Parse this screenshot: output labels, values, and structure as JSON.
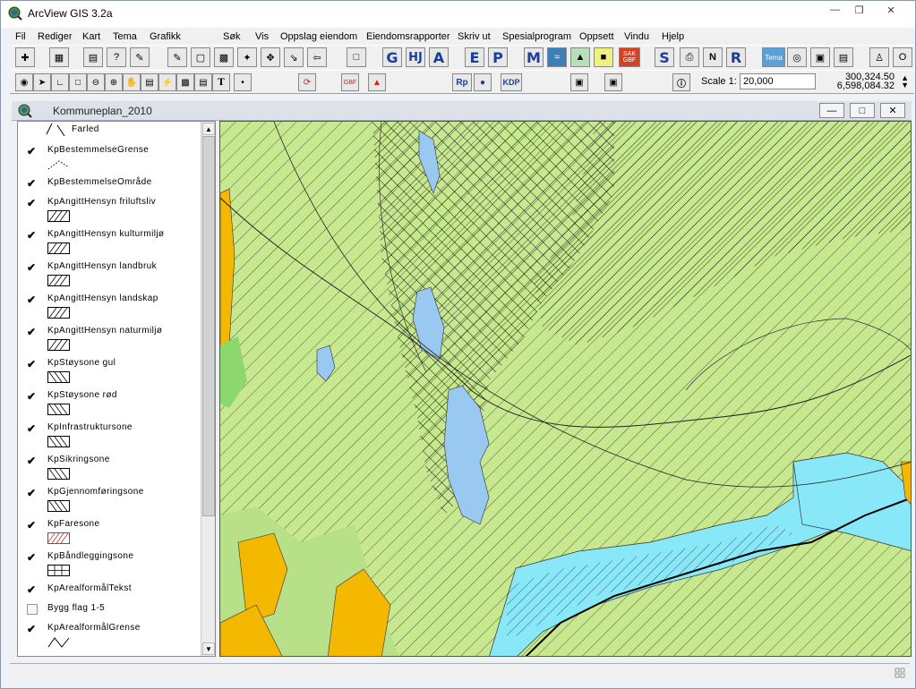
{
  "window": {
    "title": "ArcView GIS 3.2a"
  },
  "menu": [
    "Fil",
    "Rediger",
    "Kart",
    "Tema",
    "Grafikk",
    "Søk",
    "Vis",
    "Oppslag eiendom",
    "Eiendomsrapporter",
    "Skriv ut",
    "Spesialprogram",
    "Oppsett",
    "Vindu",
    "Hjelp"
  ],
  "toolbar1": {
    "letter_buttons": [
      "G",
      "HJ",
      "A",
      "E",
      "P",
      "M",
      "S",
      "N",
      "R"
    ],
    "gbf_label": "GBF",
    "sak_label": "SAK GBF",
    "tema_label": "Tema"
  },
  "toolbar2": {
    "rp_label": "Rp",
    "kdp_label": "KDP",
    "gbf_label": "GBF",
    "scale_label": "Scale 1:",
    "scale_value": "20,000",
    "x_coord": "300,324.50",
    "y_coord": "6,598,084.32"
  },
  "view": {
    "title": "Kommuneplan_2010"
  },
  "themes": [
    {
      "name": "Farled",
      "checked": null,
      "symbol": "arrow-line"
    },
    {
      "name": "KpBestemmelseGrense",
      "checked": true,
      "symbol": "dotted-line"
    },
    {
      "name": "KpBestemmelseOmråde",
      "checked": true,
      "symbol": "none"
    },
    {
      "name": "KpAngittHensyn friluftsliv",
      "checked": true,
      "symbol": "hatch"
    },
    {
      "name": "KpAngittHensyn kulturmiljø",
      "checked": true,
      "symbol": "hatch"
    },
    {
      "name": "KpAngittHensyn landbruk",
      "checked": true,
      "symbol": "hatch"
    },
    {
      "name": "KpAngittHensyn landskap",
      "checked": true,
      "symbol": "hatch"
    },
    {
      "name": "KpAngittHensyn naturmiljø",
      "checked": true,
      "symbol": "hatch"
    },
    {
      "name": "KpStøysone gul",
      "checked": true,
      "symbol": "hatch-back"
    },
    {
      "name": "KpStøysone rød",
      "checked": true,
      "symbol": "hatch-back"
    },
    {
      "name": "KpInfrastruktursone",
      "checked": true,
      "symbol": "hatch-back"
    },
    {
      "name": "KpSikringsone",
      "checked": true,
      "symbol": "hatch-back"
    },
    {
      "name": "KpGjennomføringsone",
      "checked": true,
      "symbol": "hatch-back"
    },
    {
      "name": "KpFaresone",
      "checked": true,
      "symbol": "hatch-red"
    },
    {
      "name": "KpBåndleggingsone",
      "checked": true,
      "symbol": "grid"
    },
    {
      "name": "KpArealformålTekst",
      "checked": true,
      "symbol": "none"
    },
    {
      "name": "Bygg flag 1-5",
      "checked": false,
      "symbol": "none"
    },
    {
      "name": "KpArealformålGrense",
      "checked": true,
      "symbol": "zigzag"
    }
  ],
  "colors": {
    "map_background": "#c8e890",
    "water": "#99c8f0",
    "water_light": "#88e8f8",
    "built_area": "#f5b800",
    "green_zone": "#8cd86c",
    "accent_blue": "#1a3e9c"
  }
}
